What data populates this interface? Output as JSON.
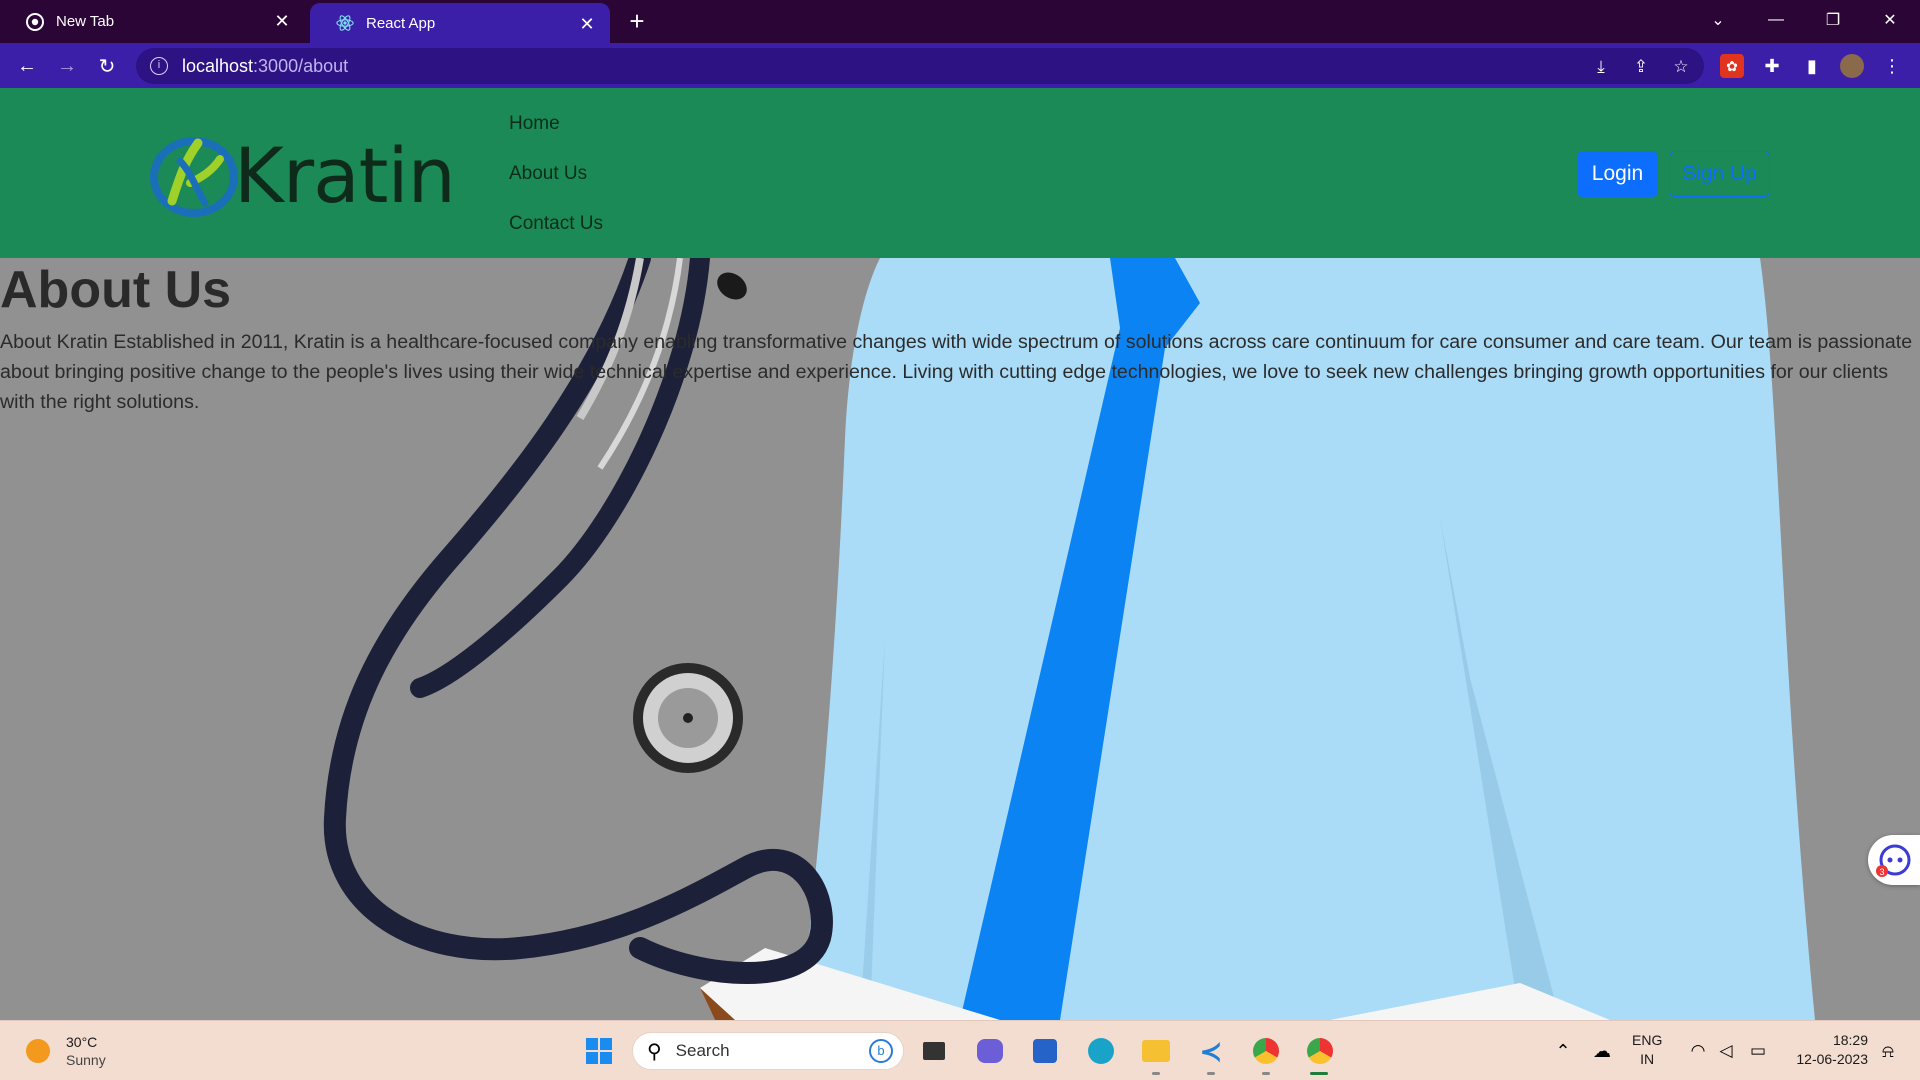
{
  "browser": {
    "tabs": [
      {
        "title": "New Tab",
        "icon": "chrome-icon"
      },
      {
        "title": "React App",
        "icon": "react-icon",
        "active": true
      }
    ],
    "url_host": "localhost",
    "url_path": ":3000/about"
  },
  "site": {
    "brand": "Kratin",
    "nav": [
      "Home",
      "About Us",
      "Contact Us"
    ],
    "login_label": "Login",
    "signup_label": "Sign Up",
    "colors": {
      "header": "#1b8a56",
      "primary": "#0d6efd"
    }
  },
  "about": {
    "title": "About Us",
    "body": "About Kratin Established in 2011, Kratin is a healthcare-focused company enabling transformative changes with wide spectrum of solutions across care continuum for care consumer and care team. Our team is passionate about bringing positive change to the people's lives using their wide technical expertise and experience. Living with cutting edge technologies, we love to seek new challenges bringing growth opportunities for our clients with the right solutions."
  },
  "chat_badge": "3",
  "taskbar": {
    "temperature": "30°C",
    "condition": "Sunny",
    "search_label": "Search",
    "lang_line1": "ENG",
    "lang_line2": "IN",
    "time": "18:29",
    "date": "12-06-2023"
  }
}
